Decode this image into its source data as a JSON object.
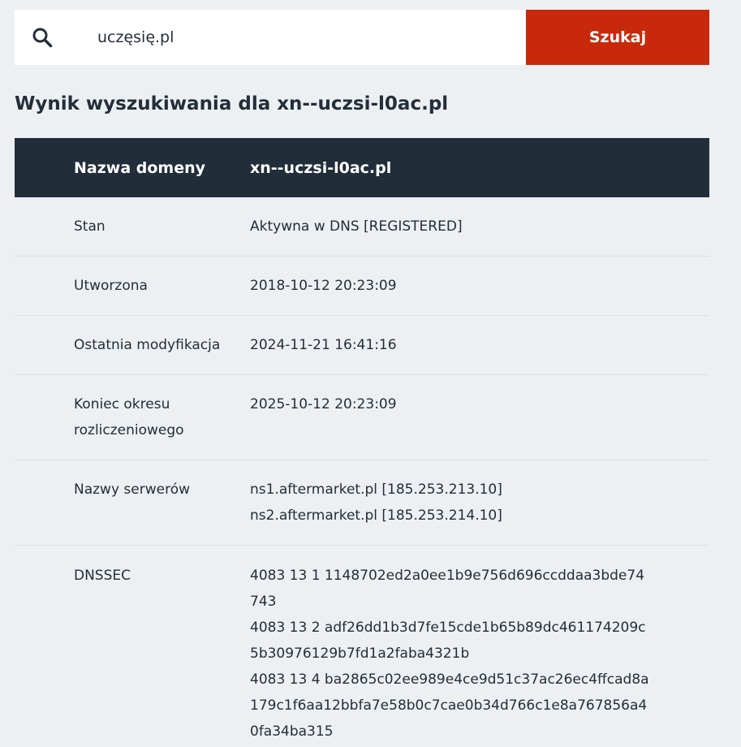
{
  "search": {
    "value": "uczęsię.pl",
    "button_label": "Szukaj"
  },
  "title": "Wynik wyszukiwania dla xn--uczsi-l0ac.pl",
  "table": {
    "header_label": "Nazwa domeny",
    "header_value": "xn--uczsi-l0ac.pl",
    "rows": [
      {
        "label": "Stan",
        "values": [
          "Aktywna w DNS [REGISTERED]"
        ]
      },
      {
        "label": "Utworzona",
        "values": [
          "2018-10-12 20:23:09"
        ]
      },
      {
        "label": "Ostatnia modyfikacja",
        "values": [
          "2024-11-21 16:41:16"
        ]
      },
      {
        "label": "Koniec okresu rozliczeniowego",
        "values": [
          "2025-10-12 20:23:09"
        ]
      },
      {
        "label": "Nazwy serwerów",
        "values": [
          "ns1.aftermarket.pl [185.253.213.10]",
          "ns2.aftermarket.pl [185.253.214.10]"
        ]
      },
      {
        "label": "DNSSEC",
        "values": [
          "4083 13 1 1148702ed2a0ee1b9e756d696ccddaa3bde74743",
          "4083 13 2 adf26dd1b3d7fe15cde1b65b89dc461174209c5b30976129b7fd1a2faba4321b",
          "4083 13 4 ba2865c02ee989e4ce9d51c37ac26ec4ffcad8a179c1f6aa12bbfa7e58b0c7cae0b34d766c1e8a767856a40fa34ba315"
        ]
      }
    ]
  },
  "colors": {
    "accent": "#c8290b",
    "header_bg": "#212e3a",
    "page_bg": "#edf0f2"
  }
}
